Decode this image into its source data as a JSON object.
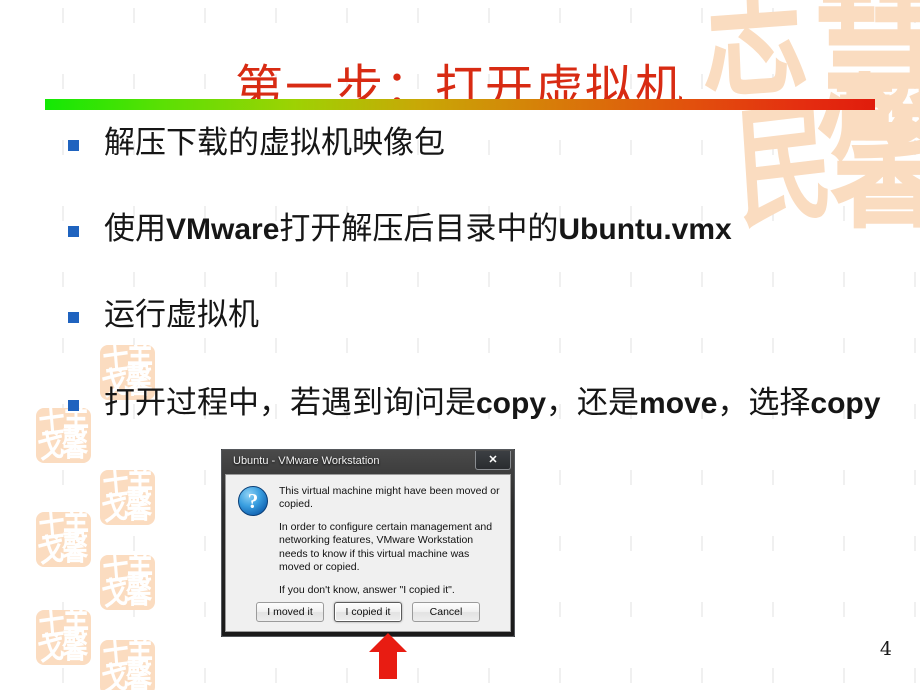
{
  "slide": {
    "title": "第一步：打开虚拟机",
    "page_number": "4",
    "accent_gradient_start": "#13e805",
    "accent_gradient_end": "#e01c0c",
    "title_color": "#d82b13",
    "bullet_marker_color": "#1f63bf",
    "watermark_color": "#fadcc0"
  },
  "bullets": [
    {
      "text": "解压下载的虚拟机映像包"
    },
    {
      "text": "使用VMware打开解压后目录中的Ubuntu.vmx"
    },
    {
      "text": "运行虚拟机"
    },
    {
      "text": "打开过程中，若遇到询问是copy，还是move，选择copy"
    }
  ],
  "dialog": {
    "title": "Ubuntu - VMware Workstation",
    "close_label": "✕",
    "icon": "question-icon",
    "icon_glyph": "?",
    "paragraphs": [
      "This virtual machine might have been moved or copied.",
      "In order to configure certain management and networking features, VMware Workstation needs to know if this virtual machine was moved or copied.",
      "If you don't know, answer \"I copied it\"."
    ],
    "buttons": [
      {
        "label": "I moved it",
        "focused": false
      },
      {
        "label": "I copied it",
        "focused": true
      },
      {
        "label": "Cancel",
        "focused": false
      }
    ]
  },
  "annotation": {
    "arrow": "red-up-arrow",
    "arrow_color": "#e81c12",
    "points_at": "I copied it"
  },
  "watermarks": {
    "big_glyphs": [
      "志",
      "慧",
      "民",
      "馨"
    ],
    "stamp_glyphs": [
      "士",
      "羊",
      "戈",
      "馨"
    ]
  }
}
